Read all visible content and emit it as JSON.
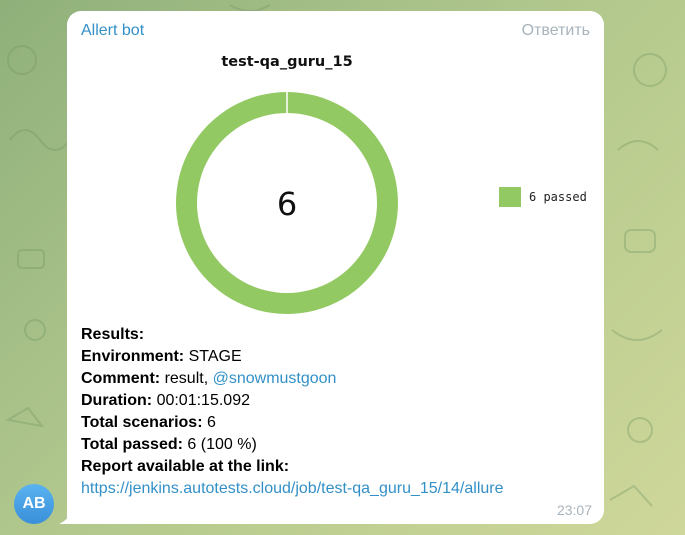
{
  "message": {
    "sender": "Allert bot",
    "reply_label": "Ответить",
    "time": "23:07"
  },
  "avatar": {
    "initials": "AB"
  },
  "chart_data": {
    "type": "pie",
    "title": "test-qa_guru_15",
    "center_label": "6",
    "categories": [
      "passed"
    ],
    "values": [
      6
    ],
    "colors": [
      "#93c963"
    ],
    "legend": [
      "6 passed"
    ],
    "legend_position": "right"
  },
  "results": {
    "heading": "Results:",
    "environment_label": "Environment:",
    "environment_value": "STAGE",
    "comment_label": "Comment:",
    "comment_value": "result,",
    "comment_mention": "@snowmustgoon",
    "duration_label": "Duration:",
    "duration_value": "00:01:15.092",
    "total_scenarios_label": "Total scenarios:",
    "total_scenarios_value": "6",
    "total_passed_label": "Total passed:",
    "total_passed_value": "6 (100 %)",
    "report_label": "Report available at the link:",
    "report_link": "https://jenkins.autotests.cloud/job/test-qa_guru_15/14/allure"
  },
  "colors": {
    "accent": "#3390c7",
    "muted": "#a8b3bb",
    "passed": "#93c963"
  }
}
